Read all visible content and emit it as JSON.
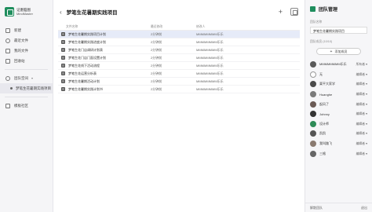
{
  "brand": {
    "name": "记墨脑图",
    "sub": "MindMaster"
  },
  "sidebar": {
    "items": [
      {
        "label": "新建",
        "icon": "new-file-icon"
      },
      {
        "label": "最近文件",
        "icon": "clock-icon"
      },
      {
        "label": "我的文件",
        "icon": "folder-icon"
      },
      {
        "label": "回收站",
        "icon": "trash-icon"
      }
    ],
    "team": {
      "label": "团队空间",
      "icon": "team-icon"
    },
    "team_sub": "梦笔生花暑期实践项目",
    "template": {
      "label": "模板社区",
      "icon": "template-icon"
    }
  },
  "header": {
    "title": "梦笔生花暑期实践项目",
    "add": "+"
  },
  "table": {
    "headers": [
      "文件名称",
      "最近修改",
      "修改人"
    ],
    "rows": [
      {
        "name": "梦笔生花暑期实践项目计划",
        "time": "2分钟前",
        "user": "MMMMMMMM乐乐",
        "selected": true
      },
      {
        "name": "梦笔生花暑期实践进度计划",
        "time": "2分钟前",
        "user": "MMMMMMMM乐乐",
        "selected": false
      },
      {
        "name": "梦笔生花门店调研计划表",
        "time": "2分钟前",
        "user": "MMMMMMMM乐乐",
        "selected": false
      },
      {
        "name": "梦笔生花门店门面设置计划",
        "time": "2分钟前",
        "user": "MMMMMMMM乐乐",
        "selected": false
      },
      {
        "name": "梦笔生花线下活动流程",
        "time": "2分钟前",
        "user": "MMMMMMMM乐乐",
        "selected": false
      },
      {
        "name": "梦笔生花运营分析表",
        "time": "2分钟前",
        "user": "MMMMMMMM乐乐",
        "selected": false
      },
      {
        "name": "梦笔生花暑期活动计划",
        "time": "2分钟前",
        "user": "MMMMMMMM乐乐",
        "selected": false
      },
      {
        "name": "梦笔生花暑期实践计划书",
        "time": "2分钟前",
        "user": "MMMMMMMM乐乐",
        "selected": false
      }
    ]
  },
  "panel": {
    "title": "团队管理",
    "name_label": "团队名称",
    "name_value": "梦笔生花暑期实践项目",
    "members_label": "团队成员 (10/10)",
    "add_label": "添加成员",
    "members": [
      {
        "name": "MMMMMMMM乐乐",
        "role": "所有者",
        "color": "#5a5a5a"
      },
      {
        "name": "无",
        "role": "编辑者",
        "color": "#ffffff"
      },
      {
        "name": "栗平大家学",
        "role": "编辑者",
        "color": "#4a4a4a"
      },
      {
        "name": "Huanghe",
        "role": "编辑者",
        "color": "#7a7a7a"
      },
      {
        "name": "起风了",
        "role": "编辑者",
        "color": "#6a5a55"
      },
      {
        "name": "Johnny",
        "role": "编辑者",
        "color": "#333333"
      },
      {
        "name": "设计师",
        "role": "编辑者",
        "color": "#2e8b57"
      },
      {
        "name": "凯凯",
        "role": "编辑者",
        "color": "#555555"
      },
      {
        "name": "我叫路飞",
        "role": "编辑者",
        "color": "#8a7a70"
      },
      {
        "name": "三格",
        "role": "编辑者",
        "color": "#666666"
      }
    ],
    "footer_left": "解散团队",
    "footer_right": "退出"
  }
}
